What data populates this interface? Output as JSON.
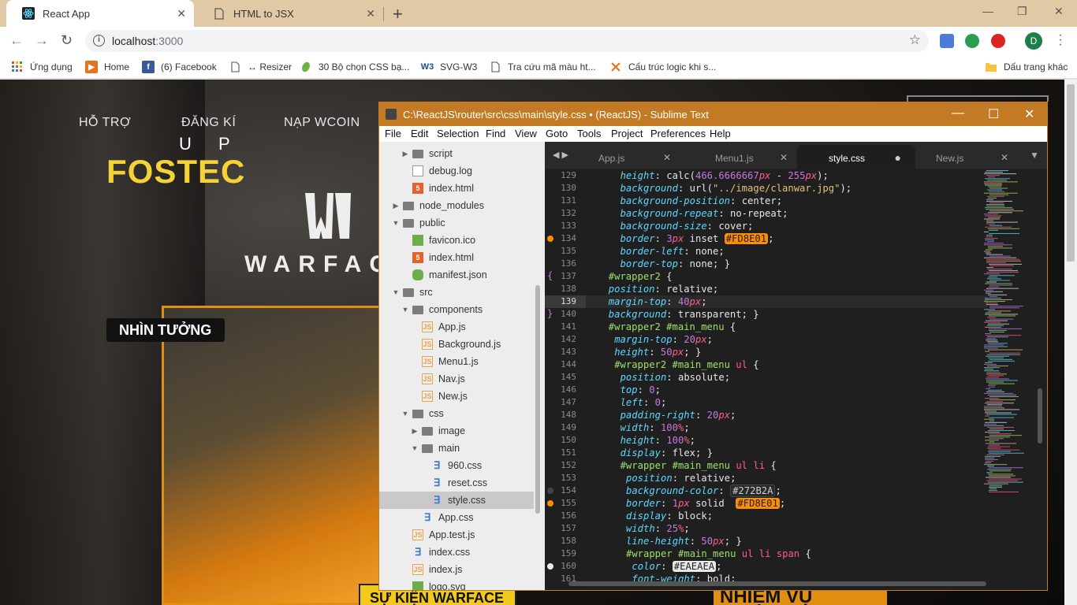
{
  "browser": {
    "tabs": [
      {
        "title": "React App",
        "active": true,
        "icon": "react-icon"
      },
      {
        "title": "HTML to JSX",
        "active": false,
        "icon": "page-icon"
      }
    ],
    "new_tab": "+",
    "window_controls": {
      "minimize": "—",
      "maximize": "❐",
      "close": "✕"
    },
    "nav": {
      "back": "←",
      "forward": "→",
      "reload": "↻"
    },
    "url": {
      "host": "localhost",
      "port": ":3000"
    },
    "profile_initial": "D",
    "bookmarks": [
      {
        "label": "Ứng dụng",
        "icon": "apps-icon"
      },
      {
        "label": "Home",
        "icon": "home-icon"
      },
      {
        "label": "(6) Facebook",
        "icon": "facebook-icon"
      },
      {
        "label": "↔ Resizer",
        "icon": "page-icon"
      },
      {
        "label": "30 Bộ chọn CSS bạ...",
        "icon": "leaf-icon"
      },
      {
        "label": "SVG-W3",
        "icon": "w3c-icon"
      },
      {
        "label": "Tra cứu mã màu ht...",
        "icon": "page-icon"
      },
      {
        "label": "Cấu trúc logic khi s...",
        "icon": "logic-icon"
      },
      {
        "label": "Dấu trang khác",
        "icon": "folder-icon"
      }
    ]
  },
  "webpage": {
    "nav": [
      "HỖ TRỢ",
      "ĐĂNG KÍ",
      "NẠP WCOIN"
    ],
    "logo_text": "WARFAC",
    "banner_up": "U P",
    "banner_title": "FOSTEC",
    "banner_button": "NHÌN TƯỞNG",
    "bottom_left": "SỰ KIỆN WARFACE",
    "bottom_right": "NHIỆM VỤ"
  },
  "sublime": {
    "title": "C:\\ReactJS\\router\\src\\css\\main\\style.css • (ReactJS) - Sublime Text",
    "menu": [
      "File",
      "Edit",
      "Selection",
      "Find",
      "View",
      "Goto",
      "Tools",
      "Project",
      "Preferences",
      "Help"
    ],
    "tabs": [
      {
        "label": "App.js",
        "active": false
      },
      {
        "label": "Menu1.js",
        "active": false
      },
      {
        "label": "style.css",
        "active": true
      },
      {
        "label": "New.js",
        "active": false
      }
    ],
    "tree": [
      {
        "label": "script",
        "type": "folder",
        "depth": 2,
        "arrow": "▶"
      },
      {
        "label": "debug.log",
        "type": "log",
        "depth": 2,
        "arrow": ""
      },
      {
        "label": "index.html",
        "type": "html",
        "depth": 2,
        "arrow": ""
      },
      {
        "label": "node_modules",
        "type": "folder",
        "depth": 1,
        "arrow": "▶"
      },
      {
        "label": "public",
        "type": "folder",
        "depth": 1,
        "arrow": "▼"
      },
      {
        "label": "favicon.ico",
        "type": "img",
        "depth": 2,
        "arrow": ""
      },
      {
        "label": "index.html",
        "type": "html",
        "depth": 2,
        "arrow": ""
      },
      {
        "label": "manifest.json",
        "type": "json",
        "depth": 2,
        "arrow": ""
      },
      {
        "label": "src",
        "type": "folder",
        "depth": 1,
        "arrow": "▼"
      },
      {
        "label": "components",
        "type": "folder",
        "depth": 2,
        "arrow": "▼"
      },
      {
        "label": "App.js",
        "type": "js",
        "depth": 3,
        "arrow": ""
      },
      {
        "label": "Background.js",
        "type": "js",
        "depth": 3,
        "arrow": ""
      },
      {
        "label": "Menu1.js",
        "type": "js",
        "depth": 3,
        "arrow": ""
      },
      {
        "label": "Nav.js",
        "type": "js",
        "depth": 3,
        "arrow": ""
      },
      {
        "label": "New.js",
        "type": "js",
        "depth": 3,
        "arrow": ""
      },
      {
        "label": "css",
        "type": "folder",
        "depth": 2,
        "arrow": "▼"
      },
      {
        "label": "image",
        "type": "folder",
        "depth": 3,
        "arrow": "▶"
      },
      {
        "label": "main",
        "type": "folder",
        "depth": 3,
        "arrow": "▼"
      },
      {
        "label": "960.css",
        "type": "css",
        "depth": 4,
        "arrow": ""
      },
      {
        "label": "reset.css",
        "type": "css",
        "depth": 4,
        "arrow": ""
      },
      {
        "label": "style.css",
        "type": "css",
        "depth": 4,
        "arrow": "",
        "selected": true
      },
      {
        "label": "App.css",
        "type": "css",
        "depth": 3,
        "arrow": ""
      },
      {
        "label": "App.test.js",
        "type": "js",
        "depth": 2,
        "arrow": ""
      },
      {
        "label": "index.css",
        "type": "css",
        "depth": 2,
        "arrow": ""
      },
      {
        "label": "index.js",
        "type": "js",
        "depth": 2,
        "arrow": ""
      },
      {
        "label": "logo.svg",
        "type": "img",
        "depth": 2,
        "arrow": ""
      }
    ],
    "current_line": 139,
    "swatch_colors": {
      "#FD8E01": "#FD8E01",
      "#272B2A": "#272B2A",
      "#EAEAEA": "#EAEAEA"
    },
    "code": [
      {
        "n": 129,
        "indent": 4,
        "t": [
          [
            "prop",
            "height"
          ],
          [
            "punct",
            ": calc("
          ],
          [
            "num",
            "466.6666667"
          ],
          [
            "unit",
            "px"
          ],
          [
            "punct",
            " - "
          ],
          [
            "num",
            "255"
          ],
          [
            "unit",
            "px"
          ],
          [
            "punct",
            ");"
          ]
        ]
      },
      {
        "n": 130,
        "indent": 4,
        "t": [
          [
            "prop",
            "background"
          ],
          [
            "punct",
            ": url("
          ],
          [
            "str",
            "\"../image/clanwar.jpg\""
          ],
          [
            "punct",
            ");"
          ]
        ]
      },
      {
        "n": 131,
        "indent": 4,
        "t": [
          [
            "prop",
            "background-position"
          ],
          [
            "punct",
            ": "
          ],
          [
            "val",
            "center"
          ],
          [
            "punct",
            ";"
          ]
        ]
      },
      {
        "n": 132,
        "indent": 4,
        "t": [
          [
            "prop",
            "background-repeat"
          ],
          [
            "punct",
            ": "
          ],
          [
            "val",
            "no-repeat"
          ],
          [
            "punct",
            ";"
          ]
        ]
      },
      {
        "n": 133,
        "indent": 4,
        "t": [
          [
            "prop",
            "background-size"
          ],
          [
            "punct",
            ": "
          ],
          [
            "val",
            "cover"
          ],
          [
            "punct",
            ";"
          ]
        ]
      },
      {
        "n": 134,
        "indent": 4,
        "t": [
          [
            "prop",
            "border"
          ],
          [
            "punct",
            ": "
          ],
          [
            "num",
            "3"
          ],
          [
            "unit",
            "px"
          ],
          [
            "val",
            " inset "
          ],
          [
            "sw1",
            "#FD8E01"
          ],
          [
            "punct",
            ";"
          ]
        ]
      },
      {
        "n": 135,
        "indent": 4,
        "t": [
          [
            "prop",
            "border-left"
          ],
          [
            "punct",
            ": "
          ],
          [
            "val",
            "none"
          ],
          [
            "punct",
            ";"
          ]
        ]
      },
      {
        "n": 136,
        "indent": 4,
        "t": [
          [
            "prop",
            "border-top"
          ],
          [
            "punct",
            ": "
          ],
          [
            "val",
            "none"
          ],
          [
            "punct",
            "; }"
          ]
        ]
      },
      {
        "n": 137,
        "indent": 2,
        "t": [
          [
            "sel",
            "#wrapper2"
          ],
          [
            "punct",
            " {"
          ]
        ]
      },
      {
        "n": 138,
        "indent": 2,
        "t": [
          [
            "prop",
            "position"
          ],
          [
            "punct",
            ": "
          ],
          [
            "val",
            "relative"
          ],
          [
            "punct",
            ";"
          ]
        ]
      },
      {
        "n": 139,
        "indent": 2,
        "t": [
          [
            "prop",
            "margin-top"
          ],
          [
            "punct",
            ": "
          ],
          [
            "num",
            "40"
          ],
          [
            "unit",
            "px"
          ],
          [
            "punct",
            ";"
          ]
        ]
      },
      {
        "n": 140,
        "indent": 2,
        "t": [
          [
            "prop",
            "background"
          ],
          [
            "punct",
            ": "
          ],
          [
            "val",
            "transparent"
          ],
          [
            "punct",
            "; }"
          ]
        ]
      },
      {
        "n": 141,
        "indent": 2,
        "t": [
          [
            "sel",
            "#wrapper2 #main_menu"
          ],
          [
            "punct",
            " {"
          ]
        ]
      },
      {
        "n": 142,
        "indent": 3,
        "t": [
          [
            "prop",
            "margin-top"
          ],
          [
            "punct",
            ": "
          ],
          [
            "num",
            "20"
          ],
          [
            "unit",
            "px"
          ],
          [
            "punct",
            ";"
          ]
        ]
      },
      {
        "n": 143,
        "indent": 3,
        "t": [
          [
            "prop",
            "height"
          ],
          [
            "punct",
            ": "
          ],
          [
            "num",
            "50"
          ],
          [
            "unit",
            "px"
          ],
          [
            "punct",
            "; }"
          ]
        ]
      },
      {
        "n": 144,
        "indent": 3,
        "t": [
          [
            "sel",
            "#wrapper2 #main_menu "
          ],
          [
            "tag",
            "ul"
          ],
          [
            "punct",
            " {"
          ]
        ]
      },
      {
        "n": 145,
        "indent": 4,
        "t": [
          [
            "prop",
            "position"
          ],
          [
            "punct",
            ": "
          ],
          [
            "val",
            "absolute"
          ],
          [
            "punct",
            ";"
          ]
        ]
      },
      {
        "n": 146,
        "indent": 4,
        "t": [
          [
            "prop",
            "top"
          ],
          [
            "punct",
            ": "
          ],
          [
            "num",
            "0"
          ],
          [
            "punct",
            ";"
          ]
        ]
      },
      {
        "n": 147,
        "indent": 4,
        "t": [
          [
            "prop",
            "left"
          ],
          [
            "punct",
            ": "
          ],
          [
            "num",
            "0"
          ],
          [
            "punct",
            ";"
          ]
        ]
      },
      {
        "n": 148,
        "indent": 4,
        "t": [
          [
            "prop",
            "padding-right"
          ],
          [
            "punct",
            ": "
          ],
          [
            "num",
            "20"
          ],
          [
            "unit",
            "px"
          ],
          [
            "punct",
            ";"
          ]
        ]
      },
      {
        "n": 149,
        "indent": 4,
        "t": [
          [
            "prop",
            "width"
          ],
          [
            "punct",
            ": "
          ],
          [
            "num",
            "100"
          ],
          [
            "unit",
            "%"
          ],
          [
            "punct",
            ";"
          ]
        ]
      },
      {
        "n": 150,
        "indent": 4,
        "t": [
          [
            "prop",
            "height"
          ],
          [
            "punct",
            ": "
          ],
          [
            "num",
            "100"
          ],
          [
            "unit",
            "%"
          ],
          [
            "punct",
            ";"
          ]
        ]
      },
      {
        "n": 151,
        "indent": 4,
        "t": [
          [
            "prop",
            "display"
          ],
          [
            "punct",
            ": "
          ],
          [
            "val",
            "flex"
          ],
          [
            "punct",
            "; }"
          ]
        ]
      },
      {
        "n": 152,
        "indent": 4,
        "t": [
          [
            "sel",
            "#wrapper #main_menu "
          ],
          [
            "tag",
            "ul li"
          ],
          [
            "punct",
            " {"
          ]
        ]
      },
      {
        "n": 153,
        "indent": 5,
        "t": [
          [
            "prop",
            "position"
          ],
          [
            "punct",
            ": "
          ],
          [
            "val",
            "relative"
          ],
          [
            "punct",
            ";"
          ]
        ]
      },
      {
        "n": 154,
        "indent": 5,
        "t": [
          [
            "prop",
            "background-color"
          ],
          [
            "punct",
            ": "
          ],
          [
            "sw2",
            "#272B2A"
          ],
          [
            "punct",
            ";"
          ]
        ]
      },
      {
        "n": 155,
        "indent": 5,
        "t": [
          [
            "prop",
            "border"
          ],
          [
            "punct",
            ": "
          ],
          [
            "num",
            "1"
          ],
          [
            "unit",
            "px"
          ],
          [
            "val",
            " solid  "
          ],
          [
            "sw1",
            "#FD8E01"
          ],
          [
            "punct",
            ";"
          ]
        ]
      },
      {
        "n": 156,
        "indent": 5,
        "t": [
          [
            "prop",
            "display"
          ],
          [
            "punct",
            ": "
          ],
          [
            "val",
            "block"
          ],
          [
            "punct",
            ";"
          ]
        ]
      },
      {
        "n": 157,
        "indent": 5,
        "t": [
          [
            "prop",
            "width"
          ],
          [
            "punct",
            ": "
          ],
          [
            "num",
            "25"
          ],
          [
            "unit",
            "%"
          ],
          [
            "punct",
            ";"
          ]
        ]
      },
      {
        "n": 158,
        "indent": 5,
        "t": [
          [
            "prop",
            "line-height"
          ],
          [
            "punct",
            ": "
          ],
          [
            "num",
            "50"
          ],
          [
            "unit",
            "px"
          ],
          [
            "punct",
            "; }"
          ]
        ]
      },
      {
        "n": 159,
        "indent": 5,
        "t": [
          [
            "sel",
            "#wrapper #main_menu "
          ],
          [
            "tag",
            "ul li span"
          ],
          [
            "punct",
            " {"
          ]
        ]
      },
      {
        "n": 160,
        "indent": 6,
        "t": [
          [
            "prop",
            "color"
          ],
          [
            "punct",
            ": "
          ],
          [
            "sw3",
            "#EAEAEA"
          ],
          [
            "punct",
            ";"
          ]
        ]
      },
      {
        "n": 161,
        "indent": 6,
        "t": [
          [
            "prop",
            "font-weight"
          ],
          [
            "punct",
            ": "
          ],
          [
            "val",
            "bold"
          ],
          [
            "punct",
            ";"
          ]
        ]
      }
    ]
  }
}
